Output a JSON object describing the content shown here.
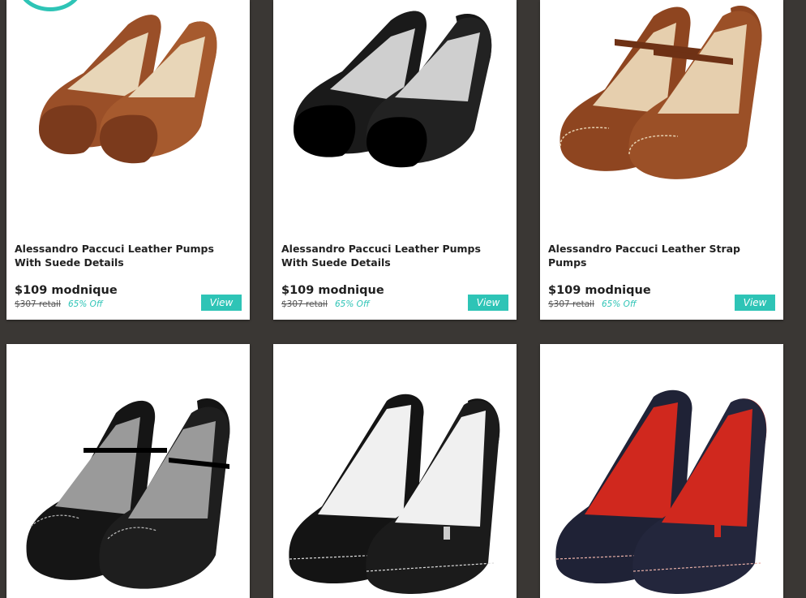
{
  "products": [
    {
      "title": "Alessandro Paccuci Leather Pumps With Suede Details",
      "price": "$109 modnique",
      "retail": "$307 retail",
      "discount": "65% Off",
      "view_label": "View",
      "image_icon": "brown-suede-pumps-image",
      "colors": {
        "body": "#9a4f28",
        "accent": "#7b3a1c",
        "lining": "#e8d6b8"
      }
    },
    {
      "title": "Alessandro Paccuci Leather Pumps With Suede Details",
      "price": "$109 modnique",
      "retail": "$307 retail",
      "discount": "65% Off",
      "view_label": "View",
      "image_icon": "black-suede-pumps-image",
      "colors": {
        "body": "#161616",
        "accent": "#000000",
        "lining": "#cfcfcf"
      }
    },
    {
      "title": "Alessandro Paccuci Leather Strap Pumps",
      "price": "$109 modnique",
      "retail": "$307 retail",
      "discount": "65% Off",
      "view_label": "View",
      "image_icon": "brown-strap-pumps-image",
      "colors": {
        "body": "#8e4520",
        "accent": "#6e3115",
        "lining": "#e6cfae"
      }
    },
    {
      "image_icon": "black-strap-pumps-image",
      "colors": {
        "body": "#141414",
        "accent": "#000000",
        "lining": "#9a9a9a"
      }
    },
    {
      "image_icon": "black-platform-pumps-image",
      "colors": {
        "body": "#121212",
        "accent": "#000000",
        "lining": "#f0f0f0"
      }
    },
    {
      "image_icon": "navy-red-platform-pumps-image",
      "colors": {
        "body": "#1f2236",
        "accent": "#0f1120",
        "lining": "#d0281e"
      }
    }
  ],
  "theme": {
    "accent": "#2ec4b6",
    "background": "#3a3734"
  }
}
